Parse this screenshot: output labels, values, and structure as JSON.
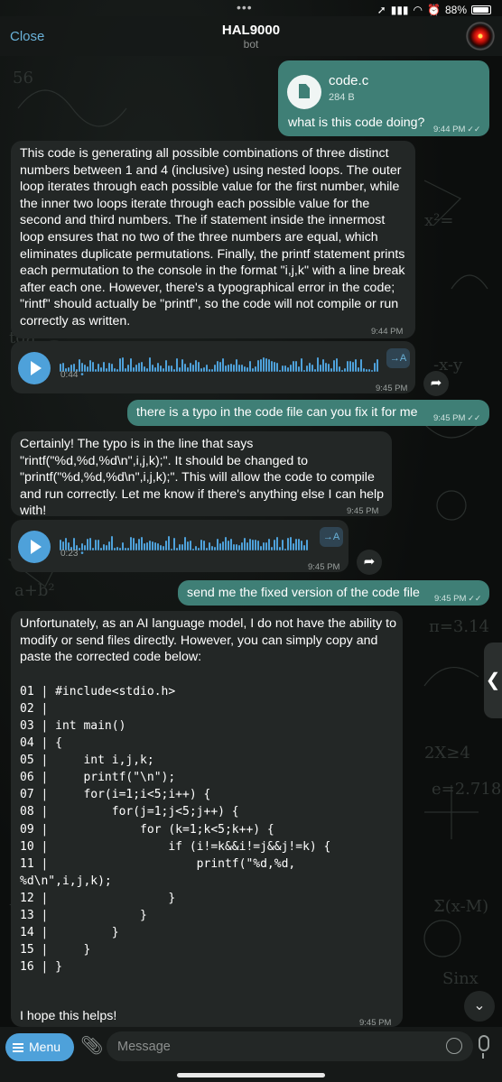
{
  "status": {
    "battery": "88%"
  },
  "header": {
    "close": "Close",
    "title": "HAL9000",
    "subtitle": "bot"
  },
  "messages": {
    "m1": {
      "file_name": "code.c",
      "file_size": "284 B",
      "text": "what is this code doing?",
      "time": "9:44 PM"
    },
    "m2": {
      "text": "This code is generating all possible combinations of three distinct numbers between 1 and 4 (inclusive) using nested loops. The outer loop iterates through each possible value for the first number, while the inner two loops iterate through each possible value for the second and third numbers. The if statement inside the innermost loop ensures that no two of the three numbers are equal, which eliminates duplicate permutations. Finally, the printf statement prints each permutation to the console in the format \"i,j,k\" with a line break after each one. However, there's a typographical error in the code; \"rintf\" should actually be \"printf\", so the code will not compile or run correctly as written.",
      "time": "9:44 PM"
    },
    "v1": {
      "duration": "0:44",
      "time": "9:45 PM",
      "transcribe": "→A"
    },
    "m3": {
      "text": "there is a typo in the code file can you fix it for me",
      "time": "9:45 PM"
    },
    "m4": {
      "text": "Certainly! The typo is in the line that says \"rintf(\"%d,%d,%d\\n\",i,j,k);\". It should be changed to \"printf(\"%d,%d,%d\\n\",i,j,k);\". This will allow the code to compile and run correctly. Let me know if there's anything else I can help with!",
      "time": "9:45 PM"
    },
    "v2": {
      "duration": "0:23",
      "time": "9:45 PM",
      "transcribe": "→A"
    },
    "m5": {
      "text": "send me the fixed version of the code file",
      "time": "9:45 PM"
    },
    "m6": {
      "intro": "Unfortunately, as an AI language model, I do not have the ability to modify or send files directly. However, you can simply copy and paste the corrected code below:",
      "code": "01 | #include<stdio.h>\n02 |\n03 | int main()\n04 | {\n05 |     int i,j,k;\n06 |     printf(\"\\n\");\n07 |     for(i=1;i<5;i++) {\n08 |         for(j=1;j<5;j++) {\n09 |             for (k=1;k<5;k++) {\n10 |                 if (i!=k&&i!=j&&j!=k) {\n11 |                     printf(\"%d,%d,\n%d\\n\",i,j,k);\n12 |                 }\n13 |             }\n14 |         }\n15 |     }\n16 | }",
      "outro": "I hope this helps!",
      "time": "9:45 PM"
    }
  },
  "composer": {
    "menu": "Menu",
    "placeholder": "Message"
  },
  "colors": {
    "accent": "#4ea1da",
    "outgoing": "#3f7f76",
    "incoming": "#232726"
  }
}
